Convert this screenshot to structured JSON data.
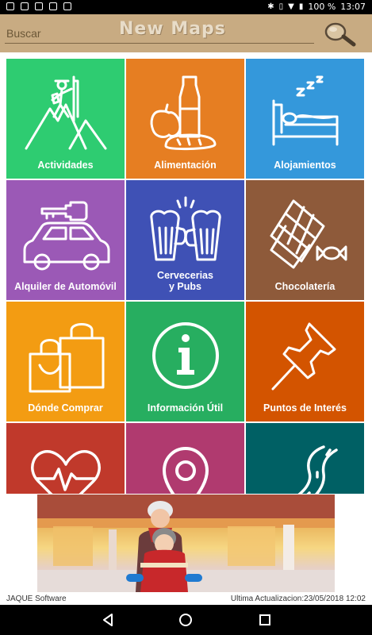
{
  "status_bar": {
    "battery": "100 %",
    "time": "13:07"
  },
  "header": {
    "search_placeholder": "Buscar",
    "title": "New Maps"
  },
  "tiles": [
    {
      "label": "Actividades",
      "color": "#2ecc71",
      "icon": "hiker-mountain-icon"
    },
    {
      "label": "Alimentación",
      "color": "#e67e22",
      "icon": "food-icon"
    },
    {
      "label": "Alojamientos",
      "color": "#3498db",
      "icon": "bed-icon"
    },
    {
      "label": "Alquiler de Automóvil",
      "color": "#9b59b6",
      "icon": "car-key-icon"
    },
    {
      "label": "Cervecerias",
      "label2": "y Pubs",
      "color": "#3f51b5",
      "icon": "beer-mugs-icon"
    },
    {
      "label": "Chocolatería",
      "color": "#8e5a3a",
      "icon": "chocolate-icon"
    },
    {
      "label": "Dónde Comprar",
      "color": "#f39c12",
      "icon": "shopping-bags-icon"
    },
    {
      "label": "Información Útil",
      "color": "#27ae60",
      "icon": "info-icon"
    },
    {
      "label": "Puntos de Interés",
      "color": "#d35400",
      "icon": "pushpin-icon"
    },
    {
      "label": "",
      "color": "#c0392b",
      "icon": "heart-pulse-icon"
    },
    {
      "label": "",
      "color": "#b03a6f",
      "icon": "map-pin-icon"
    },
    {
      "label": "",
      "color": "#006064",
      "icon": "road-icon"
    }
  ],
  "footer": {
    "company": "JAQUE Software",
    "updated": "Ultima Actualizacion:23/05/2018 12:02"
  }
}
